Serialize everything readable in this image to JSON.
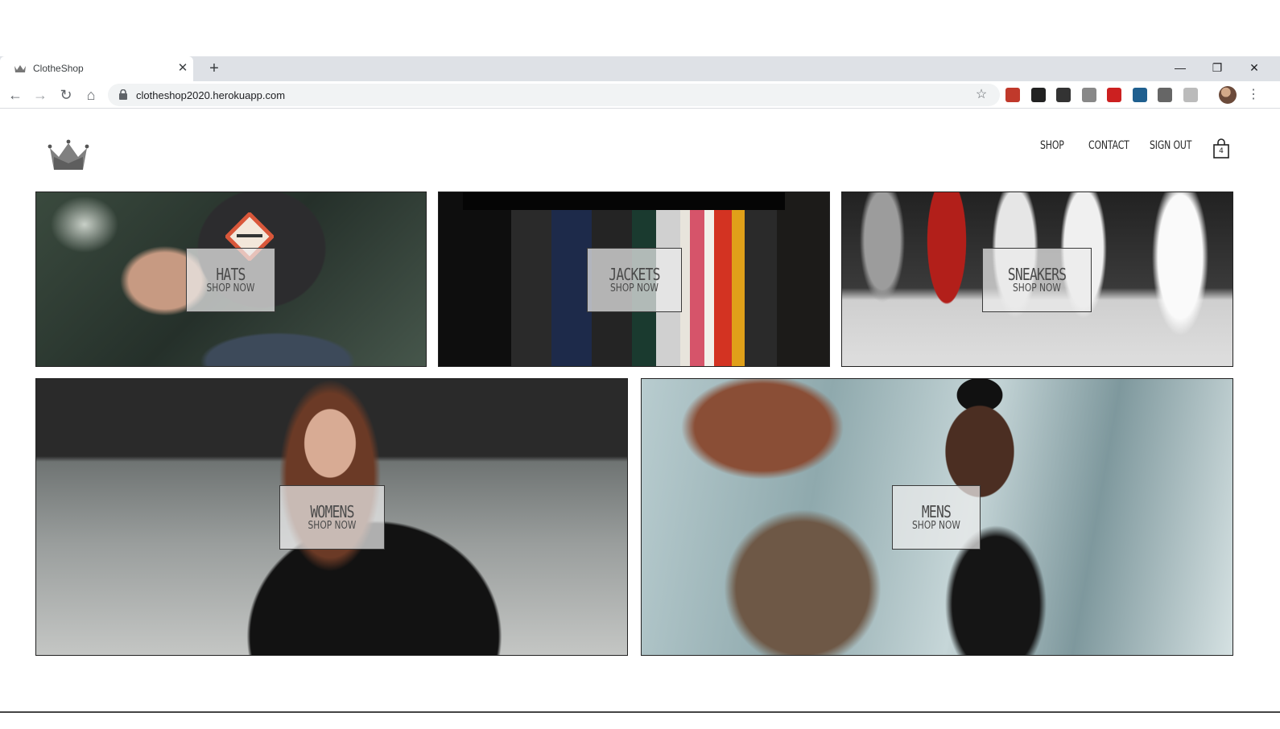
{
  "browser": {
    "tab_title": "ClotheShop",
    "tab_close": "✕",
    "new_tab": "+",
    "url": "clotheshop2020.herokuapp.com",
    "window_controls": {
      "minimize": "—",
      "maximize": "❐",
      "close": "✕"
    },
    "nav": {
      "back": "←",
      "forward": "→",
      "reload": "↻",
      "home": "⌂"
    },
    "star": "☆",
    "menu": "⋮",
    "extensions": [
      {
        "name": "ublock-icon",
        "color": "#c0392b"
      },
      {
        "name": "buffer-icon",
        "color": "#222222"
      },
      {
        "name": "bolt-icon",
        "color": "#333333"
      },
      {
        "name": "power-icon",
        "color": "#888888"
      },
      {
        "name": "lastpass-icon",
        "color": "#cc2020"
      },
      {
        "name": "react-devtools-icon",
        "color": "#1f5f8f"
      },
      {
        "name": "code-icon",
        "color": "#666666"
      },
      {
        "name": "puzzle-icon",
        "color": "#bbbbbb"
      }
    ]
  },
  "header": {
    "nav": {
      "shop": "SHOP",
      "contact": "CONTACT",
      "signout": "SIGN OUT"
    },
    "cart_count": "4"
  },
  "categories": [
    {
      "title": "HATS",
      "subtitle": "SHOP NOW"
    },
    {
      "title": "JACKETS",
      "subtitle": "SHOP NOW"
    },
    {
      "title": "SNEAKERS",
      "subtitle": "SHOP NOW"
    },
    {
      "title": "WOMENS",
      "subtitle": "SHOP NOW"
    },
    {
      "title": "MENS",
      "subtitle": "SHOP NOW"
    }
  ]
}
